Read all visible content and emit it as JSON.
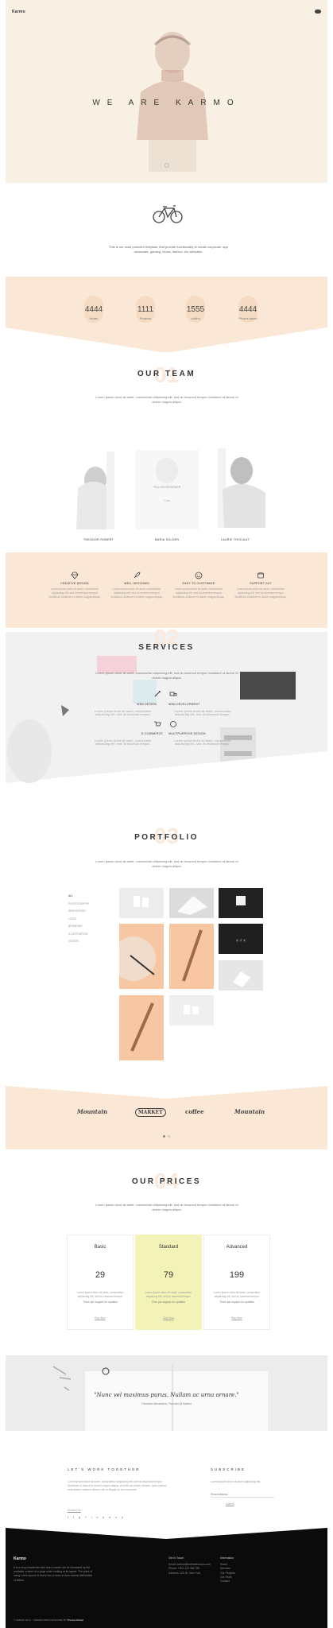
{
  "hero": {
    "logo": "Karmo",
    "title": "WE ARE KARMO"
  },
  "intro": {
    "text": "This is our most powerful template, that provide functionality to create corporate, app showcase, gaming, music, fashion, etc websites."
  },
  "stats": [
    {
      "value": "4444",
      "label": "Hours"
    },
    {
      "value": "1111",
      "label": "Projects"
    },
    {
      "value": "1555",
      "label": "coffe's"
    },
    {
      "value": "4444",
      "label": "Photos taken"
    }
  ],
  "team": {
    "number": "01",
    "title": "OUR TEAM",
    "desc": "Lorem ipsum dolor sit amet, consectetur adipiscing elit, sed do eiusmod tempor incididunt ut labore et dolore magna aliqua.",
    "members": [
      {
        "name": "THEODOR ROBERT"
      },
      {
        "name": "MARIA SOLDEN",
        "caption": "FELLOW DESIGNER"
      },
      {
        "name": "LAURIE THIOLAUT"
      }
    ]
  },
  "features": [
    {
      "title": "CREATIVE DESIGN",
      "icon": "diamond-icon",
      "desc": "Lorem ipsum dolor sit amet, consectetur adipiscing elit, sed do eiusmod tempor incididunt ut labore et dolore magna aliqua."
    },
    {
      "title": "WELL DESIGNED",
      "icon": "rocket-icon",
      "desc": "Lorem ipsum dolor sit amet, consectetur adipiscing elit, sed do eiusmod tempor incididunt ut labore et dolore magna aliqua."
    },
    {
      "title": "EASY TO CUSTOMIZE",
      "icon": "smiley-icon",
      "desc": "Lorem ipsum dolor sit amet, consectetur adipiscing elit, sed do eiusmod tempor incididunt ut labore et dolore magna aliqua."
    },
    {
      "title": "SUPPORT 24/7",
      "icon": "phone-icon",
      "desc": "Lorem ipsum dolor sit amet, consectetur adipiscing elit, sed do eiusmod tempor incididunt ut labore et dolore magna aliqua."
    }
  ],
  "services": {
    "number": "02",
    "title": "SERVICES",
    "desc": "Lorem ipsum dolor sit amet, consectetur adipiscing elit, sed do eiusmod tempor incididunt ut labore et dolore magna aliqua.",
    "items": [
      {
        "title": "WEB DESIGN",
        "desc": "Lorem ipsum dolor sit amet, consectetur adipiscing elit, sed do eiusmod tempor."
      },
      {
        "title": "WEB DEVELOPMENT",
        "desc": "Lorem ipsum dolor sit amet, consectetur adipiscing elit, sed do eiusmod tempor."
      },
      {
        "title": "E-COMMERCE",
        "desc": "Lorem ipsum dolor sit amet, consectetur adipiscing elit, sed do eiusmod tempor."
      },
      {
        "title": "MULTIPURPOSE DESIGN",
        "desc": "Lorem ipsum dolor sit amet, consectetur adipiscing elit, sed do eiusmod tempor."
      }
    ]
  },
  "portfolio": {
    "number": "03",
    "title": "PORTFOLIO",
    "desc": "Lorem ipsum dolor sit amet, consectetur adipiscing elit, sed do eiusmod tempor incididunt ut labore et dolore magna aliqua.",
    "filters": [
      "ALL",
      "PHOTOGRAPHY",
      "WEB DESIGN",
      "LOGO",
      "BRANDING",
      "ILLUSTRATION",
      "VIDEOS"
    ]
  },
  "clients": [
    "Mountain",
    "MARKET",
    "coffee",
    "Mountain"
  ],
  "prices": {
    "number": "04",
    "title": "OUR PRICES",
    "desc": "Lorem ipsum dolor sit amet, consectetur adipiscing elit, sed do eiusmod tempor incididunt ut labore et dolore magna aliqua.",
    "plans": [
      {
        "name": "Basic",
        "price": "29",
        "desc": "Lorem ipsum dolor sit amet, consectetur adipiscing elit, sed do eiusmod tempor.",
        "free": "Three per support for  updates",
        "link": "Buy Now"
      },
      {
        "name": "Standard",
        "price": "79",
        "desc": "Lorem ipsum dolor sit amet, consectetur adipiscing elit, sed do eiusmod tempor.",
        "free": "Free per support for  updates",
        "link": "Buy Now"
      },
      {
        "name": "Advanced",
        "price": "199",
        "desc": "Lorem ipsum dolor sit amet, consectetur adipiscing elit, sed do eiusmod tempor.",
        "free": "Three per support for  updates",
        "link": "Buy Now"
      }
    ]
  },
  "quote": {
    "text": "\"Nunc vel maximus purus. Nullam ac urna ornare.\"",
    "author": "Theodore Alexandrou, Founder @ Kartmo"
  },
  "contact": {
    "title": "LET'S WORK TOGETHER",
    "text": "Lorem ipsum dolor sit amet, consectetur adipiscing elit, sed do eiusmod tempor incididunt ut labore et dolore magna aliqua. Ut enim ad minim veniam, quis nostrud exercitation ullamco laboris nisi ut aliquip ex ea commodo.",
    "link": "Contact Us",
    "social": [
      "f",
      "t",
      "g+",
      "in",
      "p",
      "b",
      "v",
      "y"
    ]
  },
  "subscribe": {
    "title": "SUBSCRIBE",
    "text": "Lorem ipsum dolor sit amet adipiscing elit.",
    "placeholder": "Email address",
    "button": "Submit"
  },
  "footer": {
    "logo": "Karmo",
    "about": "It is a long established fact that a reader will be distracted by the readable content of a page when looking at its layout. The point of using Lorem Ipsum is that it has a more-or-less normal distribution of letters.",
    "col2_title": "Get in Touch",
    "col2_lines": [
      "Email: kartmo@kartmothemes.com",
      "Phone: +001 123 456 789",
      "Address: 123 St. New York"
    ],
    "col3_title": "Information",
    "col3_links": [
      "Home",
      "Services",
      "Our Projects",
      "Our Team",
      "Contact"
    ],
    "copyright": "© KARMO 2016 · THEMEFORMS DESIGNED BY",
    "credit": "Themes Robert"
  }
}
